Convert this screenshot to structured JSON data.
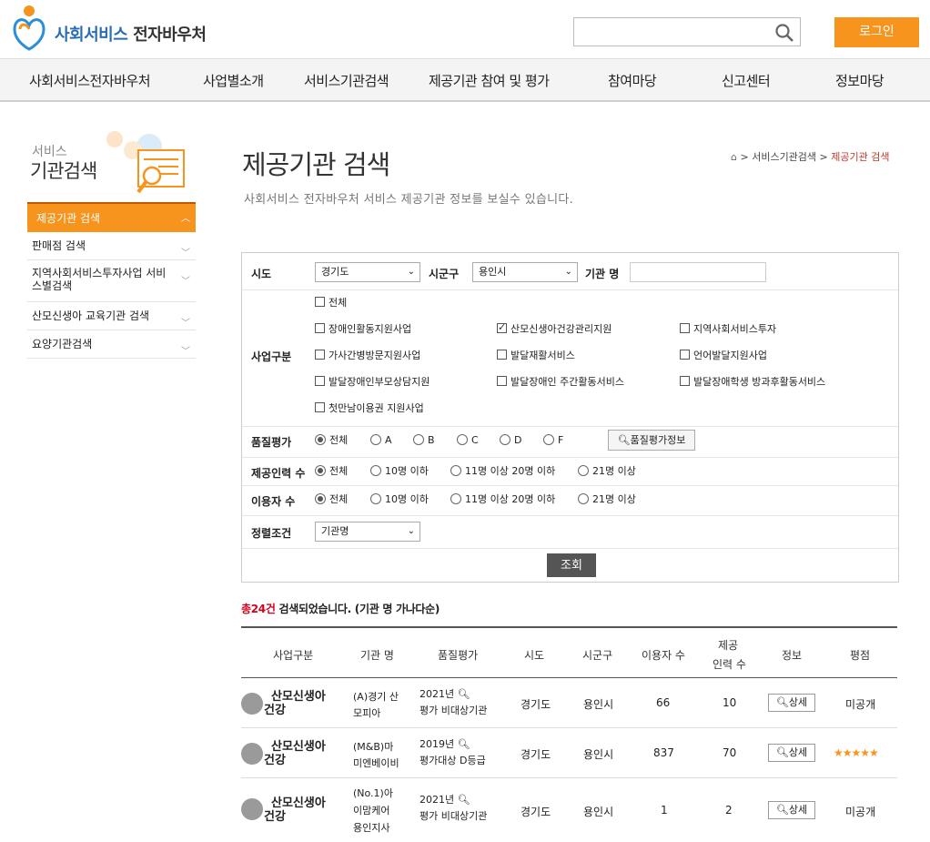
{
  "header": {
    "brand_primary": "사회서비스",
    "brand_secondary": "전자바우처",
    "search_value": "",
    "login_label": "로그인"
  },
  "gnb": {
    "items": [
      "사회서비스전자바우처",
      "사업별소개",
      "서비스기관검색",
      "제공기관 참여 및 평가",
      "참여마당",
      "신고센터",
      "정보마당"
    ]
  },
  "sidebar": {
    "title_small": "서비스",
    "title": "기관검색",
    "active": "제공기관 검색",
    "items": [
      "판매점 검색",
      "지역사회서비스투자사업 서비스별검색",
      "산모신생아 교육기관 검색",
      "요양기관검색"
    ]
  },
  "page": {
    "title": "제공기관 검색",
    "description": "사회서비스 전자바우처 서비스 제공기관 정보를 보실수 있습니다.",
    "breadcrumb": [
      "서비스기관검색",
      "제공기관 검색"
    ]
  },
  "form": {
    "sido_label": "시도",
    "sido_value": "경기도",
    "sigungu_label": "시군구",
    "sigungu_value": "용인시",
    "name_label": "기관 명",
    "name_value": "",
    "biz_label": "사업구분",
    "biz_options": [
      {
        "label": "전체",
        "checked": false
      },
      {
        "label": "장애인활동지원사업",
        "checked": false
      },
      {
        "label": "산모신생아건강관리지원",
        "checked": true
      },
      {
        "label": "지역사회서비스투자",
        "checked": false
      },
      {
        "label": "가사간병방문지원사업",
        "checked": false
      },
      {
        "label": "발달재활서비스",
        "checked": false
      },
      {
        "label": "언어발달지원사업",
        "checked": false
      },
      {
        "label": "발달장애인부모상담지원",
        "checked": false
      },
      {
        "label": "발달장애인 주간활동서비스",
        "checked": false
      },
      {
        "label": "발달장애학생 방과후활동서비스",
        "checked": false
      },
      {
        "label": "첫만남이용권 지원사업",
        "checked": false
      }
    ],
    "quality_label": "품질평가",
    "quality_options": [
      "전체",
      "A",
      "B",
      "C",
      "D",
      "F"
    ],
    "quality_selected": "전체",
    "quality_info_label": "품질평가정보",
    "staff_label": "제공인력 수",
    "staff_options": [
      "전체",
      "10명 이하",
      "11명 이상 20명 이하",
      "21명 이상"
    ],
    "users_label": "이용자 수",
    "users_options": [
      "전체",
      "10명 이하",
      "11명 이상 20명 이하",
      "21명 이상"
    ],
    "sort_label": "정렬조건",
    "sort_value": "기관명",
    "search_label": "조회"
  },
  "results": {
    "count_prefix": "총24건",
    "count_suffix": " 검색되었습니다. (기관 명 가나다순)",
    "headers": [
      "사업구분",
      "기관 명",
      "품질평가",
      "시도",
      "시군구",
      "이용자 수",
      "제공",
      "인력 수",
      "정보",
      "평점"
    ],
    "detail_label": "상세",
    "rows": [
      {
        "biz": "산모신생아",
        "biz2": "건강",
        "name1": "(A)경기 산",
        "name2": "모피아",
        "name3": "",
        "q1": "2021년",
        "q2": "평가 비대상기관",
        "sido": "경기도",
        "sigungu": "용인시",
        "users": "66",
        "staff": "10",
        "rating": "미공개"
      },
      {
        "biz": "산모신생아",
        "biz2": "건강",
        "name1": "(M&B)마",
        "name2": "미엔베이비",
        "name3": "",
        "q1": "2019년",
        "q2": "평가대상 D등급",
        "sido": "경기도",
        "sigungu": "용인시",
        "users": "837",
        "staff": "70",
        "rating": "★★★★★"
      },
      {
        "biz": "산모신생아",
        "biz2": "건강",
        "name1": "(No.1)아",
        "name2": "이맘케어",
        "name3": "용인지사",
        "q1": "2021년",
        "q2": "평가 비대상기관",
        "sido": "경기도",
        "sigungu": "용인시",
        "users": "1",
        "staff": "2",
        "rating": "미공개"
      }
    ]
  },
  "colors": {
    "accent": "#f7941d",
    "brand_blue": "#2a6db5",
    "count_red": "#d0021b"
  }
}
